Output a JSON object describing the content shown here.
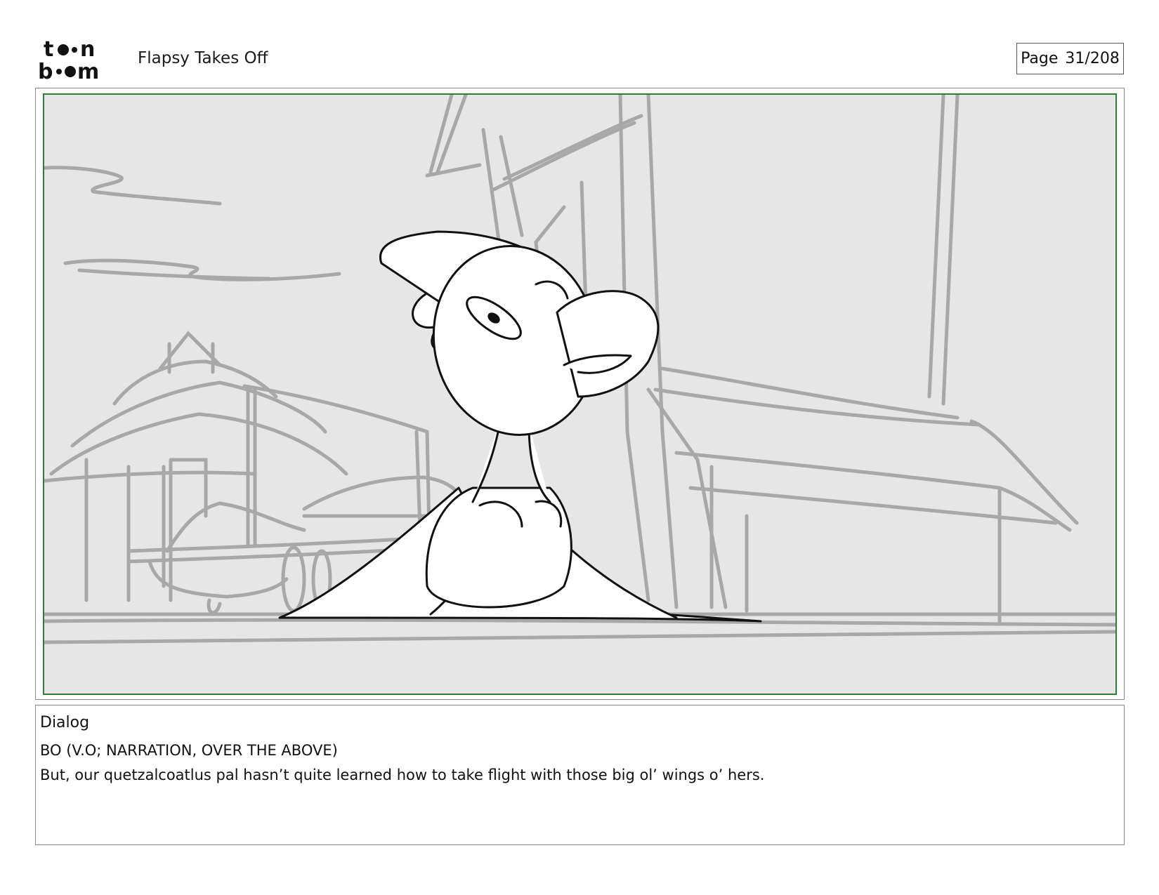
{
  "header": {
    "logo": {
      "name": "toon-boom-logo",
      "line1": "toon",
      "line2": "boom"
    },
    "document_title": "Flapsy Takes Off",
    "page_label": "Page",
    "page_number": "31/208"
  },
  "panel": {
    "frame_color": "#2e7d32",
    "background_color": "#e6e6e6"
  },
  "dialog": {
    "label": "Dialog",
    "speaker": "BO (V.O; NARRATION, OVER THE ABOVE)",
    "line": "But, our quetzalcoatlus pal hasn’t quite learned how to take flight with those big ol’ wings o’ hers."
  }
}
